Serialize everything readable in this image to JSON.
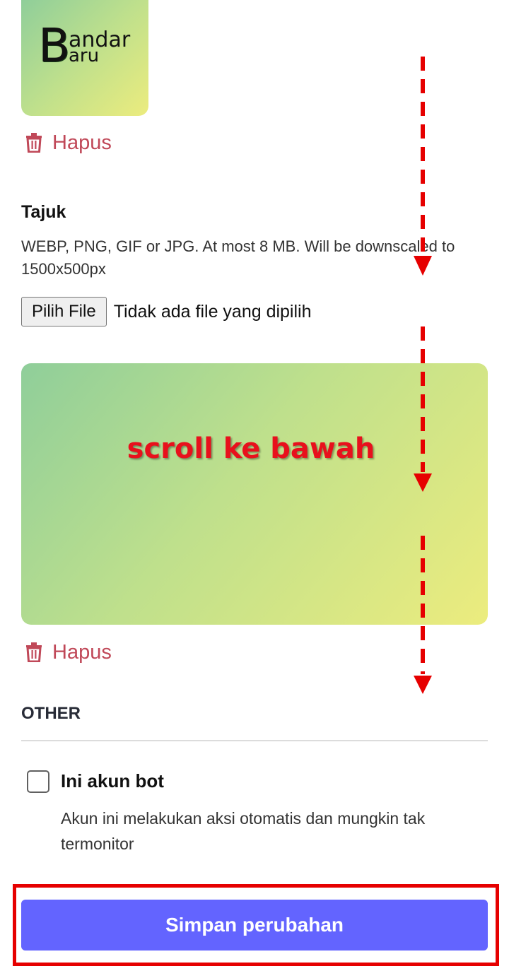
{
  "avatar": {
    "logo_big_letter": "B",
    "logo_line1": "andar",
    "logo_line2": "aru",
    "delete_label": "Hapus",
    "delete_icon": "trash-icon"
  },
  "header_field": {
    "title": "Tajuk",
    "hint": "WEBP, PNG, GIF or JPG. At most 8 MB. Will be downscaled to 1500x500px",
    "file_button": "Pilih File",
    "file_status": "Tidak ada file yang dipilih",
    "overlay_text": "scroll ke bawah",
    "delete_label": "Hapus",
    "delete_icon": "trash-icon"
  },
  "other_section": {
    "heading": "OTHER",
    "bot_checkbox_label": "Ini akun bot",
    "bot_checkbox_checked": false,
    "bot_hint": "Akun ini melakukan aksi otomatis dan mungkin tak termonitor"
  },
  "footer": {
    "save_label": "Simpan perubahan"
  },
  "colors": {
    "primary": "#6364ff",
    "danger": "#c04858",
    "annotation": "#e60000"
  }
}
